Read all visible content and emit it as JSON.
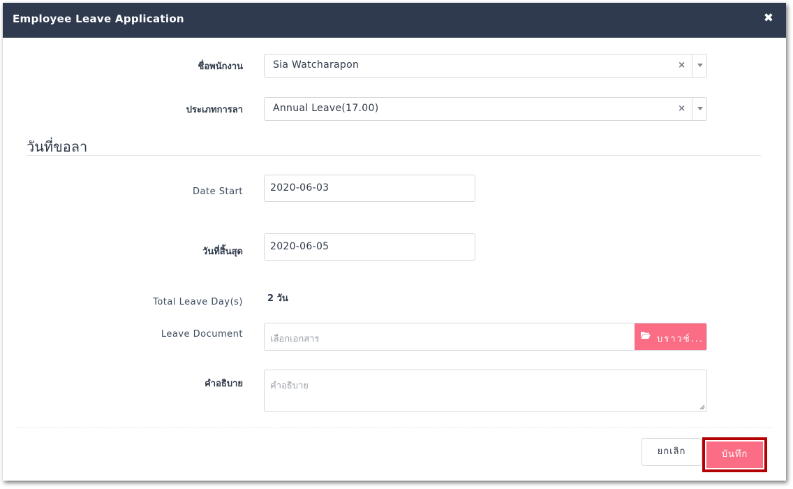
{
  "modal": {
    "title": "Employee Leave Application",
    "close_symbol": "✖"
  },
  "form": {
    "employee": {
      "label": "ชื่อพนักงาน",
      "value": "Sia Watcharapon",
      "clear_symbol": "×"
    },
    "leave_type": {
      "label": "ประเภทการลา",
      "value": "Annual Leave(17.00)",
      "clear_symbol": "×"
    },
    "section_title": "วันที่ขอลา",
    "date_start": {
      "label": "Date Start",
      "value": "2020-06-03"
    },
    "date_end": {
      "label": "วันที่สิ้นสุด",
      "value": "2020-06-05"
    },
    "total": {
      "label": "Total Leave Day(s)",
      "value": "2 วัน"
    },
    "document": {
      "label": "Leave Document",
      "placeholder": "เลือกเอกสาร",
      "browse_label": "บราวซ์...",
      "browse_icon": "folder-open-icon"
    },
    "description": {
      "label": "คำอธิบาย",
      "placeholder": "คำอธิบาย"
    }
  },
  "footer": {
    "cancel_label": "ยกเลิก",
    "save_label": "บันทึก"
  },
  "colors": {
    "header_bg": "#2f3a4f",
    "accent_pink": "#fa6d85",
    "highlight_border": "#b30000"
  }
}
